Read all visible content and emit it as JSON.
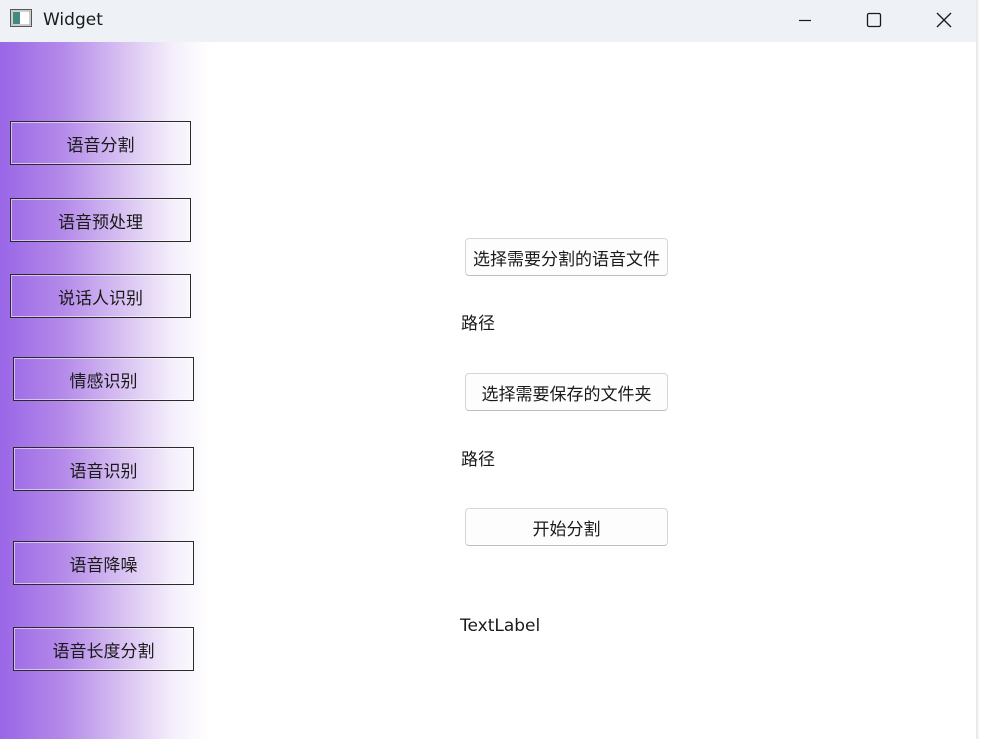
{
  "window": {
    "title": "Widget"
  },
  "sidebar": {
    "items": [
      {
        "label": "语音分割"
      },
      {
        "label": "语音预处理"
      },
      {
        "label": "说话人识别"
      },
      {
        "label": "情感识别"
      },
      {
        "label": "语音识别"
      },
      {
        "label": "语音降噪"
      },
      {
        "label": "语音长度分割"
      }
    ]
  },
  "main": {
    "select_audio_button": "选择需要分割的语音文件",
    "audio_path_label": "路径",
    "select_folder_button": "选择需要保存的文件夹",
    "folder_path_label": "路径",
    "start_button": "开始分割",
    "status_label": "TextLabel"
  },
  "icons": {
    "app": "app-window-icon",
    "minimize": "minimize-icon",
    "maximize": "maximize-icon",
    "close": "close-icon"
  },
  "colors": {
    "titlebar_bg": "#eef2f7",
    "sidebar_gradient_start": "#9966e6",
    "sidebar_gradient_end": "#ffffff"
  }
}
